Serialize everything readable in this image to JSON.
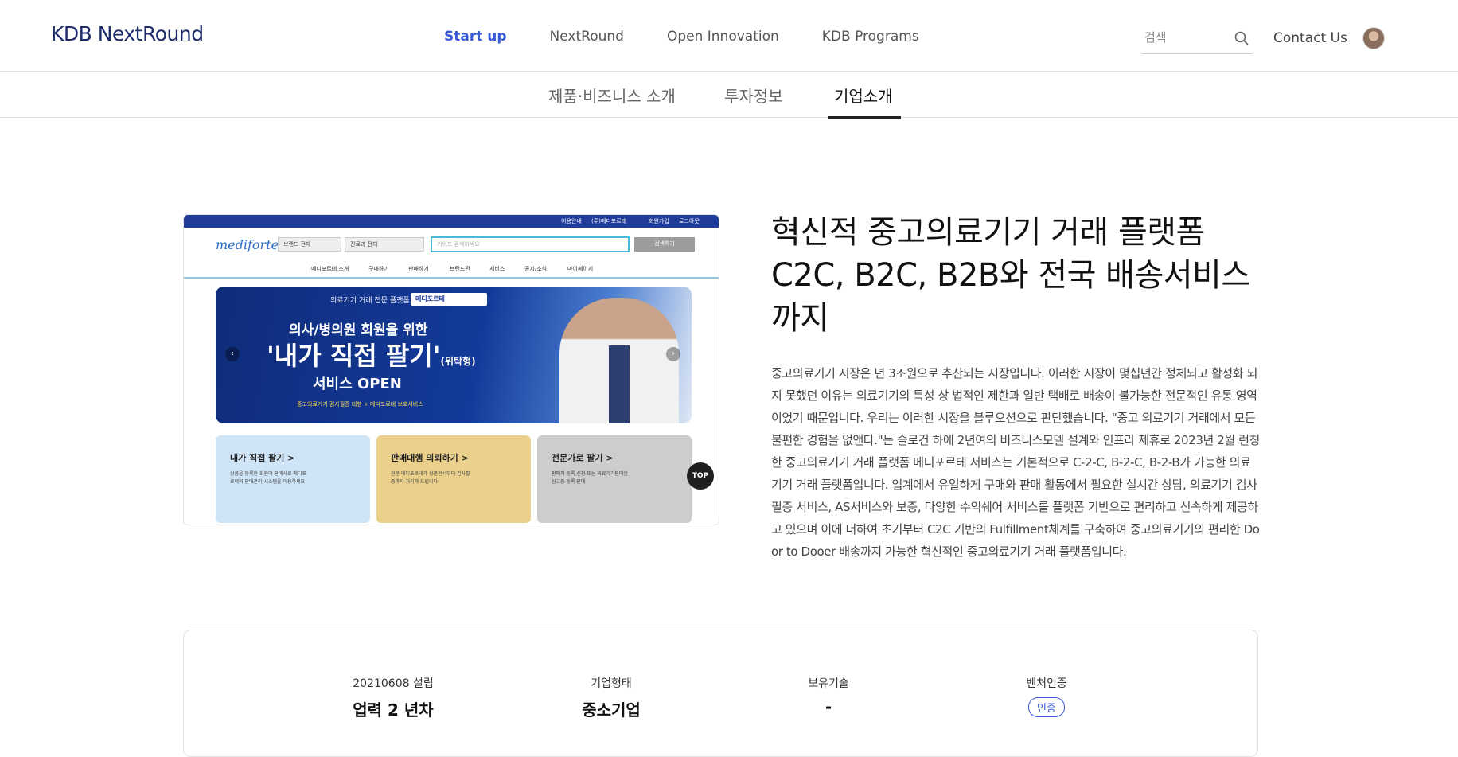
{
  "header": {
    "logo": "KDB NextRound",
    "nav": [
      "Start up",
      "NextRound",
      "Open Innovation",
      "KDB Programs"
    ],
    "search_placeholder": "검색",
    "contact": "Contact Us"
  },
  "subtabs": [
    "제품·비즈니스 소개",
    "투자정보",
    "기업소개"
  ],
  "preview": {
    "topbar_links": [
      "이용안내",
      "(주)메디포르테",
      "회원가입",
      "로그아웃"
    ],
    "logo": "mediforte",
    "select1": "브랜드 전체",
    "select2": "진료과 전체",
    "search_placeholder": "키워드 검색하세요",
    "search_button": "검색하기",
    "menu": [
      "메디포르테 소개",
      "구매하기",
      "판매하기",
      "브랜드관",
      "서비스",
      "공지/소식",
      "마이페이지"
    ],
    "banner": {
      "tag": "의료기기 거래 전문 플랫폼",
      "tag_brand": "메디포르테",
      "line1": "의사/병의원 회원을 위한",
      "line2": "'내가 직접 팔기'",
      "line2_small": "(위탁형)",
      "line3": "서비스 OPEN",
      "line4": "중고의료기기 검사필증 대행 + 메디포르테 보호서비스"
    },
    "cards": [
      {
        "title": "내가 직접 팔기 >",
        "desc": "상품을 등록한 회원이 판매사로 메디포르테의 판매관리 시스템을 이용하세요"
      },
      {
        "title": "판매대행 의뢰하기 >",
        "desc": "전문 메디포르테가 상품전시부터 검사필증까지 처리해 드립니다"
      },
      {
        "title": "전문가로 팔기 >",
        "desc": "판매자 등록 신청 또는 의료기기판매업신고증 등록 판매"
      }
    ],
    "top_label": "TOP"
  },
  "hero": {
    "title": "혁신적 중고의료기기 거래 플랫폼 C2C, B2C, B2B와 전국 배송서비스 까지",
    "description": "중고의료기기 시장은 년 3조원으로 추산되는 시장입니다. 이러한 시장이 몇십년간 정체되고 활성화 되지 못했던 이유는 의료기기의 특성 상 법적인 제한과 일반 택배로 배송이 불가능한 전문적인 유통 영역이었기 때문입니다. 우리는 이러한 시장을 블루오션으로 판단했습니다. \"중고 의료기기 거래에서 모든 불편한 경험을 없앤다.\"는 슬로건 하에 2년여의 비즈니스모델 설계와 인프라 제휴로 2023년 2월 런칭한 중고의료기기 거래 플랫폼 메디포르테 서비스는 기본적으로 C-2-C, B-2-C, B-2-B가 가능한 의료기기 거래 플랫폼입니다. 업계에서 유일하게 구매와 판매 활동에서 필요한 실시간 상담, 의료기기 검사필증 서비스, AS서비스와 보증, 다양한 수익쉐어 서비스를 플랫폼 기반으로 편리하고 신속하게 제공하고 있으며 이에 더하여 초기부터 C2C 기반의 Fulfillment체계를 구축하여 중고의료기기의 편리한 Door to Dooer 배송까지 가능한 혁신적인 중고의료기기 거래 플랫폼입니다."
  },
  "info": {
    "founded_label": "20210608 설립",
    "founded_value": "업력 2 년차",
    "type_label": "기업형태",
    "type_value": "중소기업",
    "tech_label": "보유기술",
    "tech_value": "-",
    "venture_label": "벤처인증",
    "venture_value": "인증"
  },
  "colors": {
    "accent": "#3a5bd9",
    "brand": "#1d2b6b"
  }
}
